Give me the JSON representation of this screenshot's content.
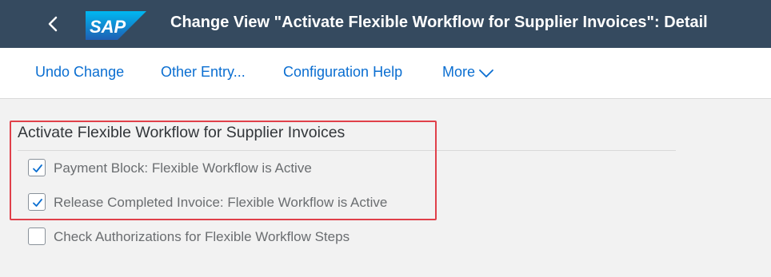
{
  "shell": {
    "title": "Change View \"Activate Flexible Workflow for Supplier Invoices\": Detail",
    "logo_text": "SAP",
    "back_icon": "chevron-left-icon",
    "brand_color": "#0a6ed1",
    "header_color": "#354a5f"
  },
  "toolbar": {
    "undo_label": "Undo Change",
    "other_entry_label": "Other Entry...",
    "config_help_label": "Configuration Help",
    "more_label": "More",
    "more_icon": "chevron-down-icon",
    "link_color": "#0a6ed1"
  },
  "section": {
    "title": "Activate Flexible Workflow for Supplier Invoices",
    "highlight_color": "#e0404a",
    "checkboxes": [
      {
        "label": "Payment Block: Flexible Workflow is Active",
        "checked": true
      },
      {
        "label": "Release Completed Invoice: Flexible Workflow is Active",
        "checked": true
      },
      {
        "label": "Check Authorizations for Flexible Workflow Steps",
        "checked": false
      }
    ]
  }
}
